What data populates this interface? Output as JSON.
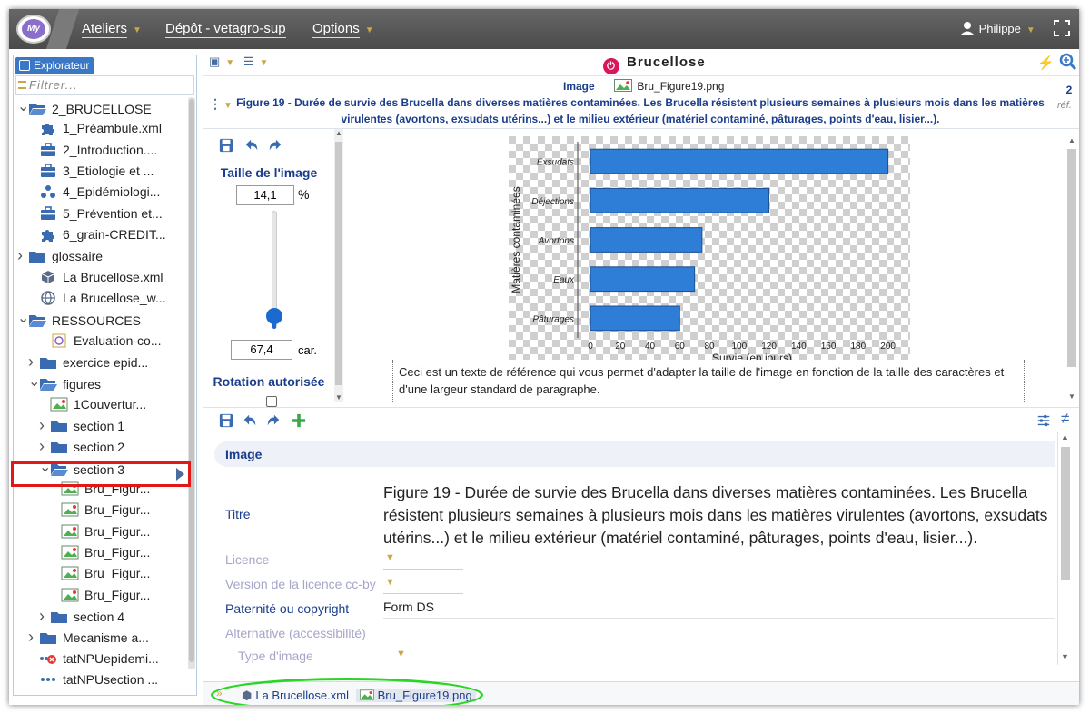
{
  "topbar": {
    "logo_text": "My",
    "menus": [
      "Ateliers",
      "Dépôt - vetagro-sup",
      "Options"
    ],
    "user": "Philippe"
  },
  "explorer": {
    "tab_label": "Explorateur",
    "filter_placeholder": "Filtrer...",
    "items": [
      {
        "label": "2_BRUCELLOSE",
        "icon": "folder-open-icon"
      },
      {
        "label": "1_Préambule.xml",
        "icon": "puzzle-icon"
      },
      {
        "label": "2_Introduction....",
        "icon": "briefcase-icon"
      },
      {
        "label": "3_Etiologie et ...",
        "icon": "briefcase-icon"
      },
      {
        "label": "4_Epidémiologi...",
        "icon": "network-icon"
      },
      {
        "label": "5_Prévention et...",
        "icon": "briefcase-icon"
      },
      {
        "label": "6_grain-CREDIT...",
        "icon": "puzzle-icon"
      },
      {
        "label": "glossaire",
        "icon": "folder-icon"
      },
      {
        "label": "La Brucellose.xml",
        "icon": "cube-icon"
      },
      {
        "label": "La Brucellose_w...",
        "icon": "globe-icon"
      },
      {
        "label": "RESSOURCES",
        "icon": "folder-open-icon"
      },
      {
        "label": "Evaluation-co...",
        "icon": "web-file-icon"
      },
      {
        "label": "exercice epid...",
        "icon": "folder-icon"
      },
      {
        "label": "figures",
        "icon": "folder-open-icon"
      },
      {
        "label": "1Couvertur...",
        "icon": "image-icon"
      },
      {
        "label": "section 1",
        "icon": "folder-icon"
      },
      {
        "label": "section 2",
        "icon": "folder-icon"
      },
      {
        "label": "section 3",
        "icon": "folder-open-icon"
      },
      {
        "label": "Bru_Figur...",
        "icon": "image-icon"
      },
      {
        "label": "Bru_Figur...",
        "icon": "image-icon"
      },
      {
        "label": "Bru_Figur...",
        "icon": "image-icon"
      },
      {
        "label": "Bru_Figur...",
        "icon": "image-icon"
      },
      {
        "label": "Bru_Figur...",
        "icon": "image-icon"
      },
      {
        "label": "Bru_Figur...",
        "icon": "image-icon"
      },
      {
        "label": "section 4",
        "icon": "folder-icon"
      },
      {
        "label": "Mecanisme a...",
        "icon": "folder-icon"
      },
      {
        "label": "tatNPUepidemi...",
        "icon": "dots-error-icon"
      },
      {
        "label": "tatNPUsection ...",
        "icon": "dots-icon"
      }
    ]
  },
  "header": {
    "document_title": "Brucellose"
  },
  "caption": {
    "type_label": "Image",
    "file_name": "Bru_Figure19.png",
    "text": "Figure 19 - Durée de survie des Brucella dans diverses matières contaminées. Les Brucella résistent plusieurs semaines à plusieurs mois dans les matières virulentes (avortons, exsudats utérins...) et le milieu extérieur (matériel contaminé, pâturages, points d'eau, lisier...).",
    "ref_count": "2",
    "ref_label": "réf."
  },
  "image_tools": {
    "size_title": "Taille de l'image",
    "size_value": "14,1",
    "size_unit": "%",
    "chars_value": "67,4",
    "chars_unit": "car.",
    "rotation_label": "Rotation autorisée",
    "slider_level": 0.1
  },
  "chart_data": {
    "type": "bar",
    "orientation": "horizontal",
    "categories": [
      "Exsudats",
      "Déjections",
      "Avortons",
      "Eaux",
      "Pâturages"
    ],
    "values": [
      200,
      120,
      75,
      70,
      60
    ],
    "xlabel": "Survie (en jours)",
    "ylabel": "Matières contaminées",
    "xlim": [
      0,
      210
    ],
    "xticks": [
      0,
      20,
      40,
      60,
      80,
      100,
      120,
      140,
      160,
      180,
      200
    ],
    "bar_color": "#2e7dd6",
    "grid": false
  },
  "reference_text": "Ceci est un texte de référence qui vous permet d'adapter la taille de l'image en fonction de la taille des caractères et d'une largeur standard de paragraphe.",
  "editor": {
    "section_title": "Image",
    "fields": {
      "titre_label": "Titre",
      "titre_value": "Figure 19 - Durée de survie des Brucella dans diverses matières contaminées. Les Brucella résistent plusieurs semaines à plusieurs mois dans les matières virulentes (avortons, exsudats utérins...) et le milieu extérieur (matériel contaminé, pâturages, points d'eau, lisier...).",
      "licence_label": "Licence",
      "version_label": "Version de la licence cc-by",
      "paternite_label": "Paternité ou copyright",
      "paternite_value": "Form DS",
      "alternative_label": "Alternative (accessibilité)",
      "type_image_label": "Type d'image"
    }
  },
  "bottom_tabs": [
    "La Brucellose.xml",
    "Bru_Figure19.png"
  ],
  "colors": {
    "accent": "#1a3d8c",
    "topbar": "#555555",
    "highlight_red": "#e01818",
    "highlight_green": "#29d623"
  }
}
